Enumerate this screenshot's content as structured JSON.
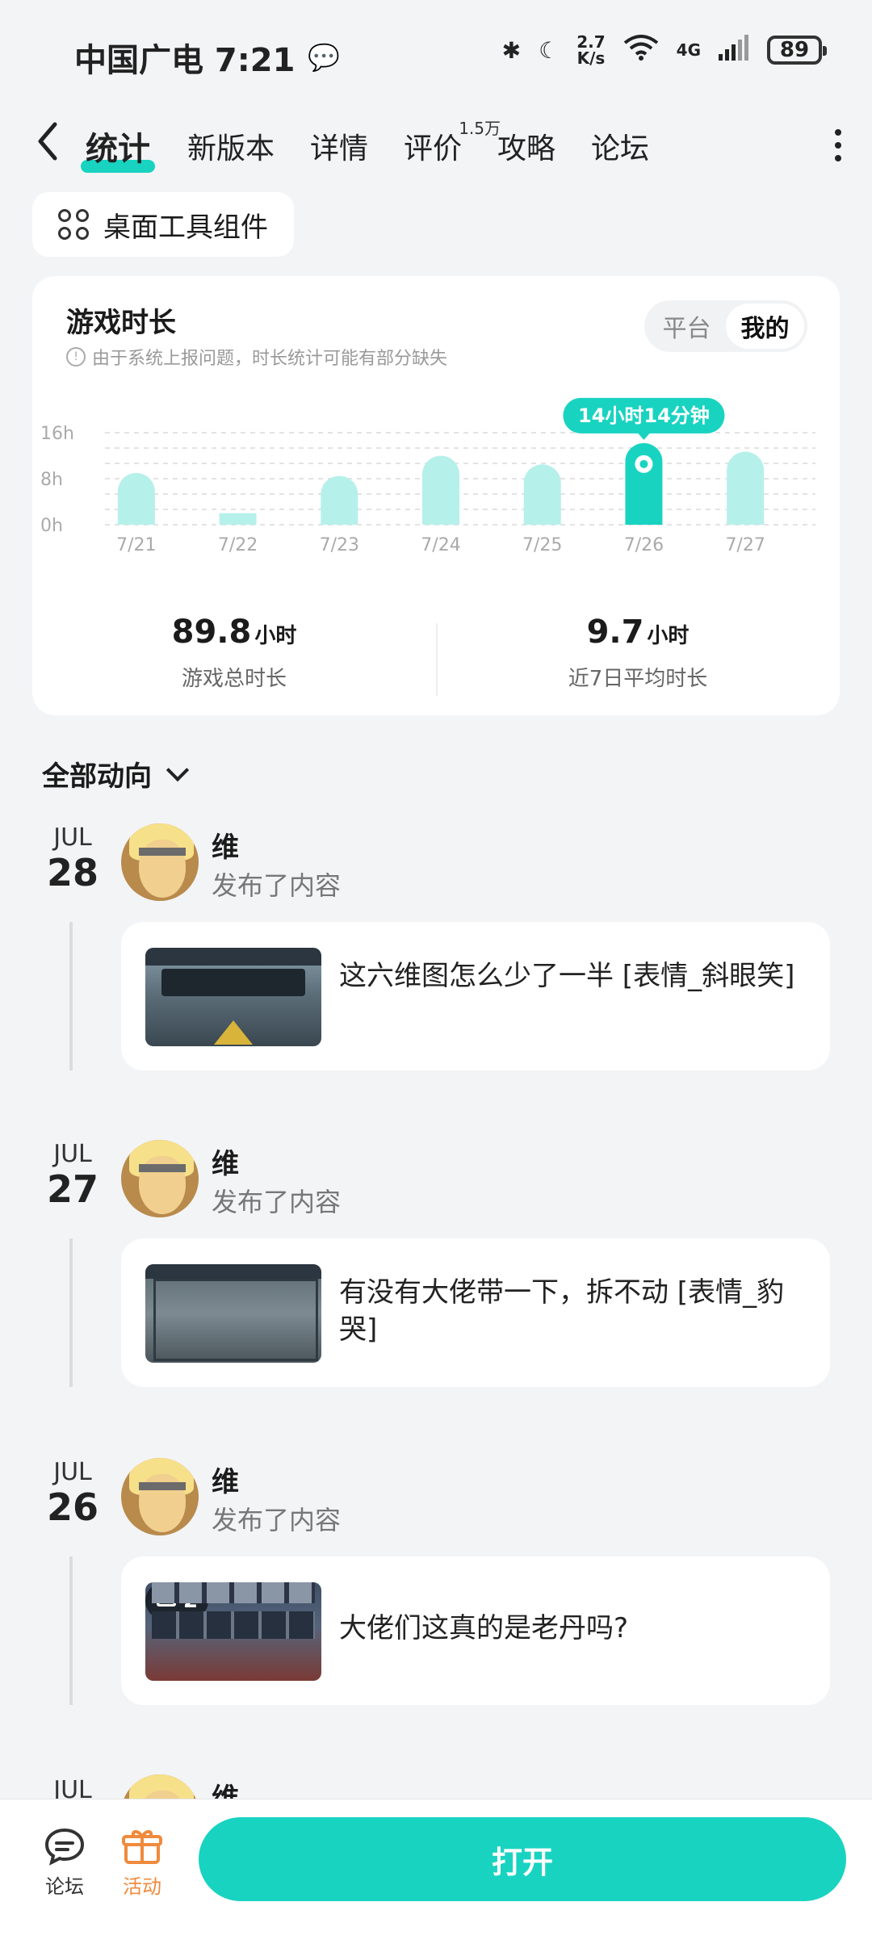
{
  "status_bar": {
    "carrier_time": "中国广电 7:21",
    "net_speed_top": "2.7",
    "net_speed_bottom": "K/s",
    "network": "4G",
    "battery": "89"
  },
  "tabs": [
    {
      "label": "统计",
      "active": true
    },
    {
      "label": "新版本"
    },
    {
      "label": "详情"
    },
    {
      "label": "评价",
      "badge": "1.5万"
    },
    {
      "label": "攻略"
    },
    {
      "label": "论坛"
    }
  ],
  "widget_chip": {
    "label": "桌面工具组件"
  },
  "stats": {
    "title": "游戏时长",
    "subtitle": "由于系统上报问题，时长统计可能有部分缺失",
    "segment": [
      "平台",
      "我的"
    ],
    "total_value": "89.8",
    "total_unit": "小时",
    "total_label": "游戏总时长",
    "avg_value": "9.7",
    "avg_unit": "小时",
    "avg_label": "近7日平均时长",
    "tooltip": "14小时14分钟"
  },
  "chart_data": {
    "type": "bar",
    "categories": [
      "7/21",
      "7/22",
      "7/23",
      "7/24",
      "7/25",
      "7/26",
      "7/27"
    ],
    "values": [
      9,
      2,
      8.5,
      12,
      10.5,
      14.2,
      12.7
    ],
    "yticks": [
      "16h",
      "8h",
      "0h"
    ],
    "ylim": [
      0,
      16
    ],
    "highlight_index": 5,
    "color_normal": "#b6f0ea",
    "color_highlight": "#19d3c1"
  },
  "feed": {
    "filter_label": "全部动向",
    "entries": [
      {
        "month": "JUL",
        "day": "28",
        "user": "维",
        "action": "发布了内容",
        "text": "这六维图怎么少了一半 [表情_斜眼笑]"
      },
      {
        "month": "JUL",
        "day": "27",
        "user": "维",
        "action": "发布了内容",
        "text": "有没有大佬带一下，拆不动 [表情_豹哭]"
      },
      {
        "month": "JUL",
        "day": "26",
        "user": "维",
        "action": "发布了内容",
        "text": "大佬们这真的是老丹吗?",
        "image_count": "2"
      },
      {
        "month": "JUL",
        "day": "",
        "user": "维",
        "action": "",
        "text": ""
      }
    ]
  },
  "bottom": {
    "forum_label": "论坛",
    "activity_label": "活动",
    "open_label": "打开"
  }
}
